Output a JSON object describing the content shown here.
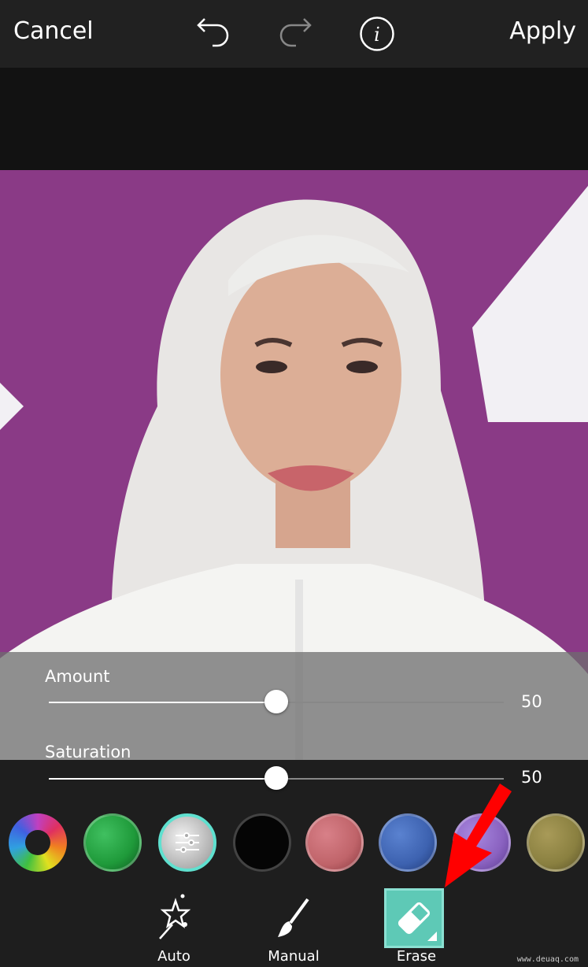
{
  "header": {
    "cancel_label": "Cancel",
    "apply_label": "Apply"
  },
  "sliders": [
    {
      "label": "Amount",
      "value": "50",
      "fraction": 0.5
    },
    {
      "label": "Saturation",
      "value": "50",
      "fraction": 0.5
    }
  ],
  "swatches": [
    {
      "name": "color-wheel",
      "color": "#c040c0"
    },
    {
      "name": "green",
      "color": "#1f9a3a"
    },
    {
      "name": "white-silver",
      "color": "#d8d8d8",
      "selected": true,
      "accent": "#5fe0cf"
    },
    {
      "name": "black",
      "color": "#050505"
    },
    {
      "name": "rose",
      "color": "#c0646a"
    },
    {
      "name": "blue",
      "color": "#3d62b0"
    },
    {
      "name": "purple",
      "color": "#8a62c0"
    },
    {
      "name": "olive",
      "color": "#8a8040"
    }
  ],
  "tools": [
    {
      "label": "Auto",
      "icon": "magic-wand-icon"
    },
    {
      "label": "Manual",
      "icon": "brush-icon"
    },
    {
      "label": "Erase",
      "icon": "eraser-icon",
      "active": true
    }
  ],
  "colors": {
    "accent": "#5ec9b6",
    "annotation_arrow": "#ff0000",
    "photo_background": "#8a3a86"
  },
  "watermark": "www.deuaq.com"
}
